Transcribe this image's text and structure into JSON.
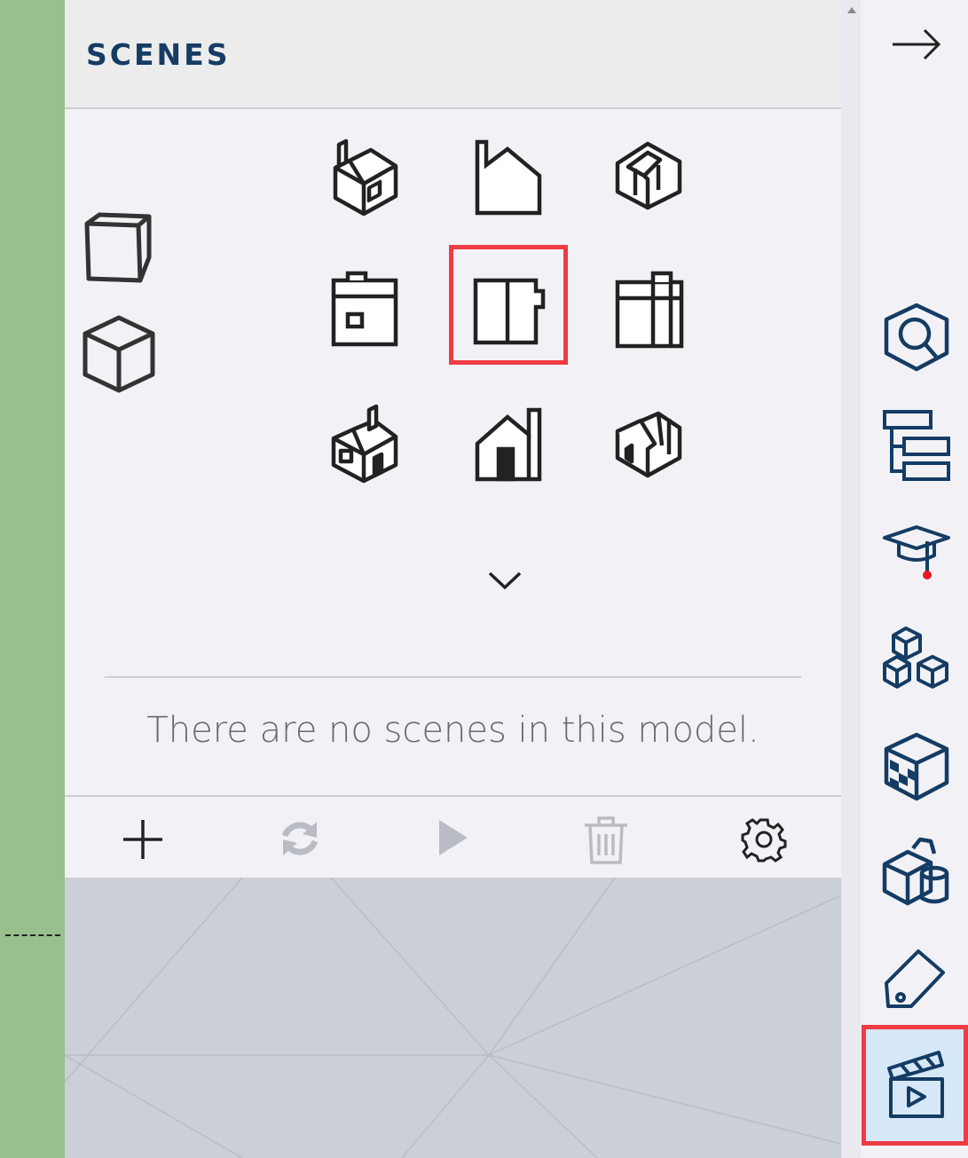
{
  "panel": {
    "title": "SCENES",
    "empty_message": "There are no scenes in this model."
  },
  "standard_views": {
    "left": [
      "iso-view",
      "cube-view"
    ],
    "grid": [
      "back-left-iso",
      "front-elevation",
      "back-right-iso",
      "left-elevation",
      "top-plan",
      "right-elevation",
      "front-left-iso",
      "back-elevation",
      "front-right-iso"
    ],
    "selected": "top-plan"
  },
  "toolbar": [
    "add-scene",
    "update-scene",
    "play-animation",
    "delete-scene",
    "scene-settings"
  ],
  "rail": {
    "items": [
      "collapse-panel",
      "entity-info",
      "outliner",
      "instructor",
      "components",
      "materials",
      "styles",
      "tags",
      "scenes"
    ],
    "active": "scenes",
    "notification_color": "#e8171f"
  },
  "colors": {
    "accent": "#143c64",
    "highlight": "#ef3b43",
    "active_bg": "#d6e8f7"
  }
}
